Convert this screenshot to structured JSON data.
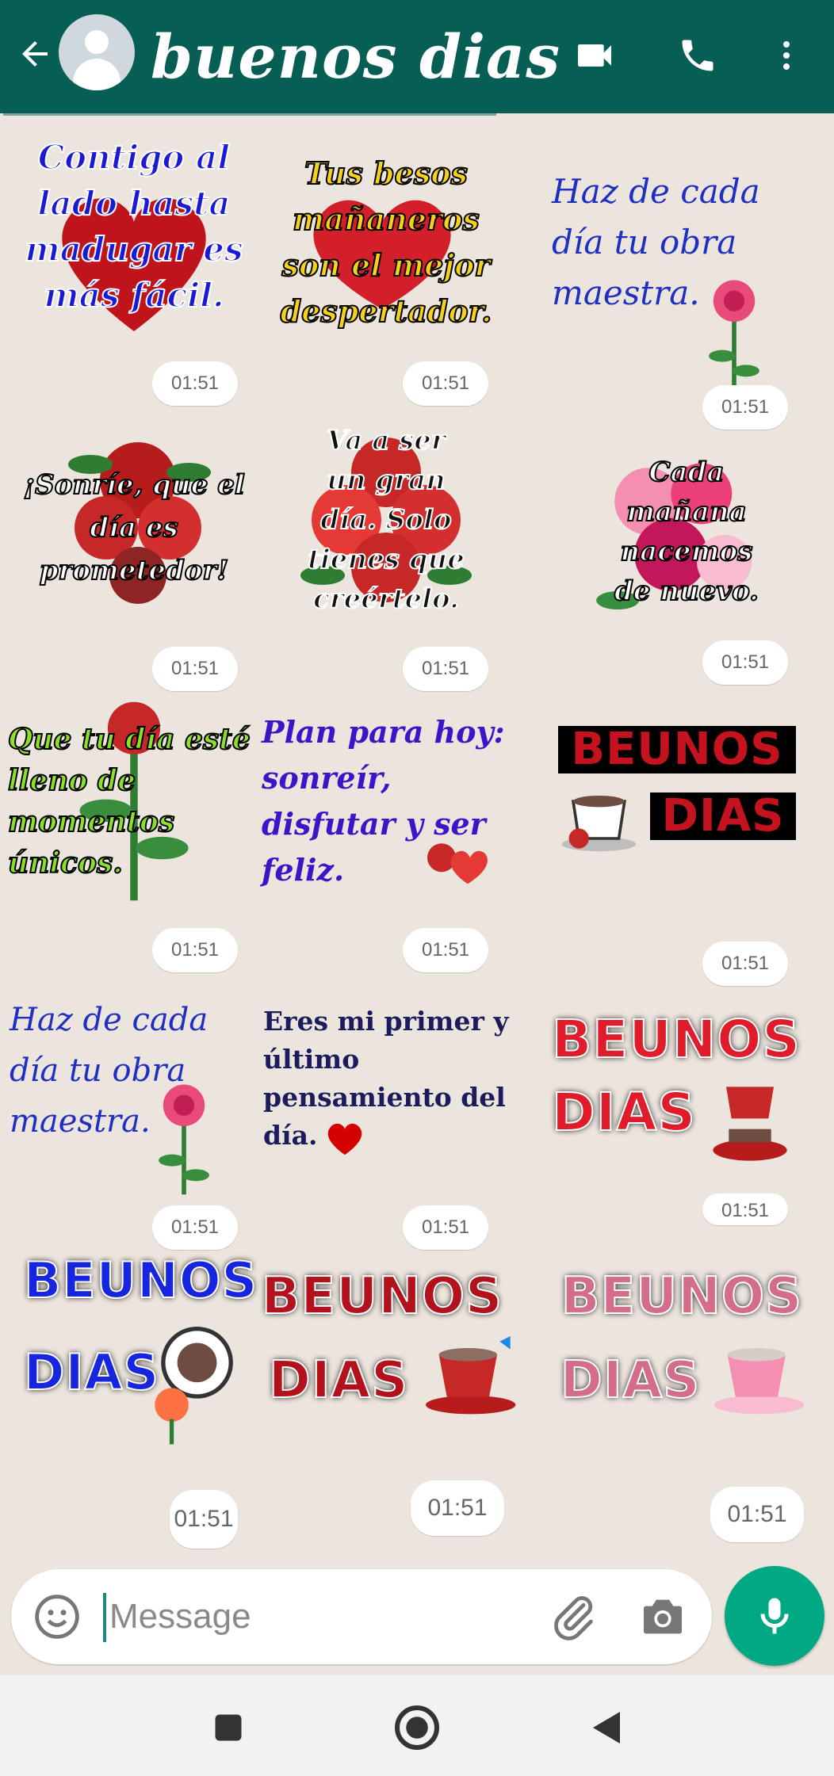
{
  "header": {
    "title": "buenos dias",
    "colors": {
      "bar": "#075e54",
      "accent": "#00a884"
    },
    "icons": [
      "back-arrow-icon",
      "avatar-icon",
      "video-call-icon",
      "phone-icon",
      "more-vert-icon"
    ]
  },
  "stickers": [
    {
      "text": "Contigo al lado hasta madugar es más fácil.",
      "time": "01:51"
    },
    {
      "text": "Tus besos mañaneros son el mejor despertador.",
      "time": "01:51"
    },
    {
      "text": "Haz de cada día tu obra maestra.",
      "time": "01:51"
    },
    {
      "text": "¡Sonríe, que el día es prometedor!",
      "time": "01:51"
    },
    {
      "text": "Va a ser un gran día. Solo tienes que creértelo.",
      "time": "01:51"
    },
    {
      "text": "Cada mañana nacemos de nuevo.",
      "time": "01:51"
    },
    {
      "text": "Que tu día esté lleno de momentos únicos.",
      "time": "01:51"
    },
    {
      "text": "Plan para hoy: sonreír, disfutar y ser feliz.",
      "time": "01:51"
    },
    {
      "line1": "BEUNOS",
      "line2": "DIAS",
      "time": "01:51"
    },
    {
      "text": "Haz de cada día tu obra maestra.",
      "time": "01:51"
    },
    {
      "text": "Eres mi primer y último pensamiento del día.",
      "time": "01:51"
    },
    {
      "line1": "BEUNOS",
      "line2": "DIAS",
      "time": "01:51"
    },
    {
      "line1": "BEUNOS",
      "line2": "DIAS",
      "time": "01:51"
    },
    {
      "line1": "BEUNOS",
      "line2": "DIAS",
      "time": "01:51"
    },
    {
      "line1": "BEUNOS",
      "line2": "DIAS",
      "time": "01:51"
    }
  ],
  "composer": {
    "placeholder": "Message",
    "icons": [
      "emoji-icon",
      "attach-icon",
      "camera-icon",
      "mic-icon"
    ]
  },
  "navbar": {
    "icons": [
      "recents-square-icon",
      "home-circle-icon",
      "back-triangle-icon"
    ]
  }
}
